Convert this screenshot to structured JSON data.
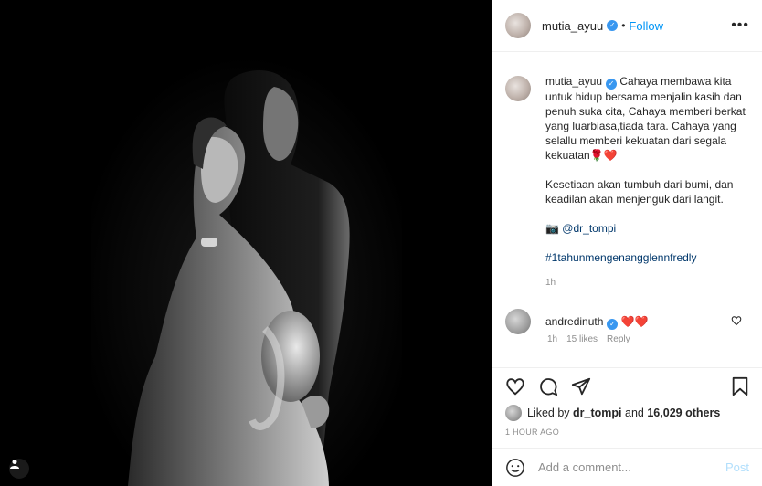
{
  "post": {
    "author": "mutia_ayuu",
    "follow_label": "Follow",
    "more_label": "•••",
    "dot_sep": "•"
  },
  "caption": {
    "author": "mutia_ayuu",
    "line1": "Cahaya membawa kita untuk hidup bersama menjalin kasih dan penuh suka cita, Cahaya memberi berkat yang luarbiasa,tiada tara. Cahaya yang selallu memberi kekuatan dari segala kekuatan🌹❤️",
    "line2": "Kesetiaan akan tumbuh dari bumi, dan keadilan akan menjenguk dari langit.",
    "camera": "📷",
    "mention": "@dr_tompi",
    "hashtag": "#1tahunmengenangglennfredly",
    "time": "1h"
  },
  "comment": {
    "author": "andredinuth",
    "text": "❤️❤️",
    "time": "1h",
    "likes": "15 likes",
    "reply": "Reply"
  },
  "likes": {
    "prefix": "Liked by",
    "user": "dr_tompi",
    "and": "and",
    "count": "16,029 others"
  },
  "timestamp": "1 HOUR AGO",
  "add_comment": {
    "placeholder": "Add a comment...",
    "post_label": "Post"
  },
  "colors": {
    "accent": "#0095f6",
    "verified": "#3897f0",
    "heart": "#ed4956"
  }
}
